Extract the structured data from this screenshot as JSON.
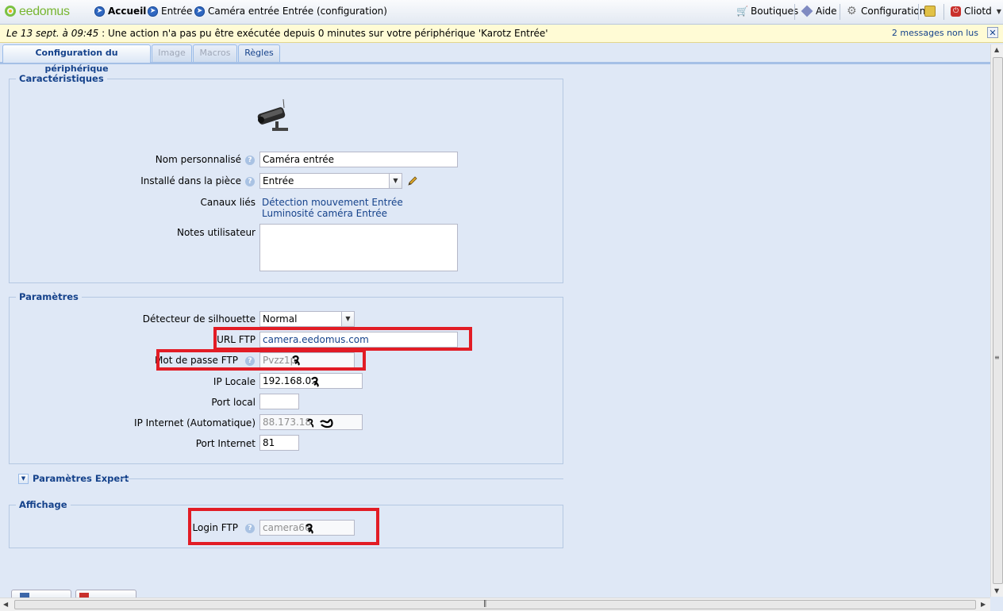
{
  "brand": {
    "name": "eedomus"
  },
  "nav": {
    "home": "Accueil",
    "room": "Entrée",
    "page": "Caméra entrée Entrée (configuration)"
  },
  "toolbar": {
    "shops": "Boutiques",
    "help": "Aide",
    "config": "Configuration",
    "user": "Cliotd"
  },
  "notification": {
    "date": "Le 13 sept. à 09:45",
    "message": " : Une action n'a pas pu être exécutée depuis 0 minutes sur votre périphérique 'Karotz Entrée'",
    "unread": "2 messages non lus"
  },
  "tabs": [
    {
      "label": "Configuration du périphérique",
      "state": "active"
    },
    {
      "label": "Image",
      "state": "disabled"
    },
    {
      "label": "Macros",
      "state": "disabled"
    },
    {
      "label": "Règles",
      "state": "normal"
    }
  ],
  "characteristics": {
    "legend": "Caractéristiques",
    "name_label": "Nom personnalisé",
    "name_value": "Caméra entrée",
    "room_label": "Installé dans la pièce",
    "room_value": "Entrée",
    "channels_label": "Canaux liés",
    "channels": [
      "Détection mouvement Entrée",
      "Luminosité caméra Entrée"
    ],
    "notes_label": "Notes utilisateur"
  },
  "parameters": {
    "legend": "Paramètres",
    "silhouette_label": "Détecteur de silhouette",
    "silhouette_value": "Normal",
    "ftp_url_label": "URL FTP",
    "ftp_url_value": "camera.eedomus.com",
    "ftp_pass_label": "Mot de passe FTP",
    "ftp_pass_value": "Pvzz1p",
    "local_ip_label": "IP Locale",
    "local_ip_value": "192.168.0.",
    "local_port_label": "Port local",
    "local_port_value": "",
    "internet_ip_label": "IP Internet (Automatique)",
    "internet_ip_value": "88.173.18",
    "internet_port_label": "Port Internet",
    "internet_port_value": "81"
  },
  "expert": {
    "legend": "Paramètres Expert"
  },
  "display": {
    "legend": "Affichage",
    "ftp_login_label": "Login FTP",
    "ftp_login_value": "camera66"
  },
  "colors": {
    "accent": "#15428b",
    "highlight": "#e21c25",
    "background": "#dfe8f6"
  }
}
